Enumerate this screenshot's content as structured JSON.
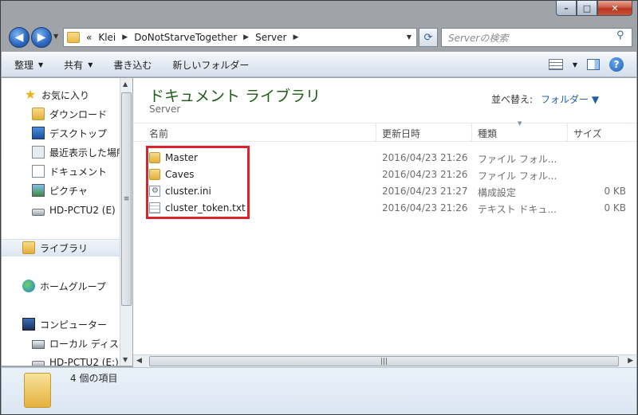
{
  "window": {
    "caption_min": "–",
    "caption_max": "□",
    "caption_close": "✕"
  },
  "nav": {
    "back_glyph": "◀",
    "forward_glyph": "▶",
    "refresh_glyph": "⟳"
  },
  "address": {
    "overflow": "«",
    "crumbs": [
      "Klei",
      "DoNotStarveTogether",
      "Server"
    ],
    "sep": "▶"
  },
  "search": {
    "placeholder": "Serverの検索"
  },
  "toolbar": {
    "organize": "整理",
    "share": "共有",
    "burn": "書き込む",
    "new_folder": "新しいフォルダー",
    "help": "?"
  },
  "sidebar": {
    "favorites": "お気に入り",
    "downloads": "ダウンロード",
    "desktop": "デスクトップ",
    "recent": "最近表示した場所",
    "documents": "ドキュメント",
    "pictures": "ピクチャ",
    "drive_e": "HD-PCTU2 (E)",
    "libraries": "ライブラリ",
    "homegroup": "ホームグループ",
    "computer": "コンピューター",
    "local_disk": "ローカル ディスク",
    "drive_e2": "HD-PCTU2 (E:)"
  },
  "content": {
    "library_title": "ドキュメント ライブラリ",
    "library_subtitle": "Server",
    "arrange_label": "並べ替え:",
    "arrange_value": "フォルダー",
    "columns": {
      "name": "名前",
      "date": "更新日時",
      "type": "種類",
      "size": "サイズ"
    },
    "files": [
      {
        "name": "Master",
        "date": "2016/04/23 21:26",
        "type": "ファイル フォル...",
        "size": "",
        "icon": "folder"
      },
      {
        "name": "Caves",
        "date": "2016/04/23 21:26",
        "type": "ファイル フォル...",
        "size": "",
        "icon": "folder"
      },
      {
        "name": "cluster.ini",
        "date": "2016/04/23 21:27",
        "type": "構成設定",
        "size": "0 KB",
        "icon": "ini"
      },
      {
        "name": "cluster_token.txt",
        "date": "2016/04/23 21:26",
        "type": "テキスト ドキュ...",
        "size": "0 KB",
        "icon": "txt"
      }
    ]
  },
  "status": {
    "item_count": "4 個の項目"
  },
  "colors": {
    "highlight": "#d8242c",
    "library_title": "#1e5e16",
    "link": "#1f5fa8"
  }
}
